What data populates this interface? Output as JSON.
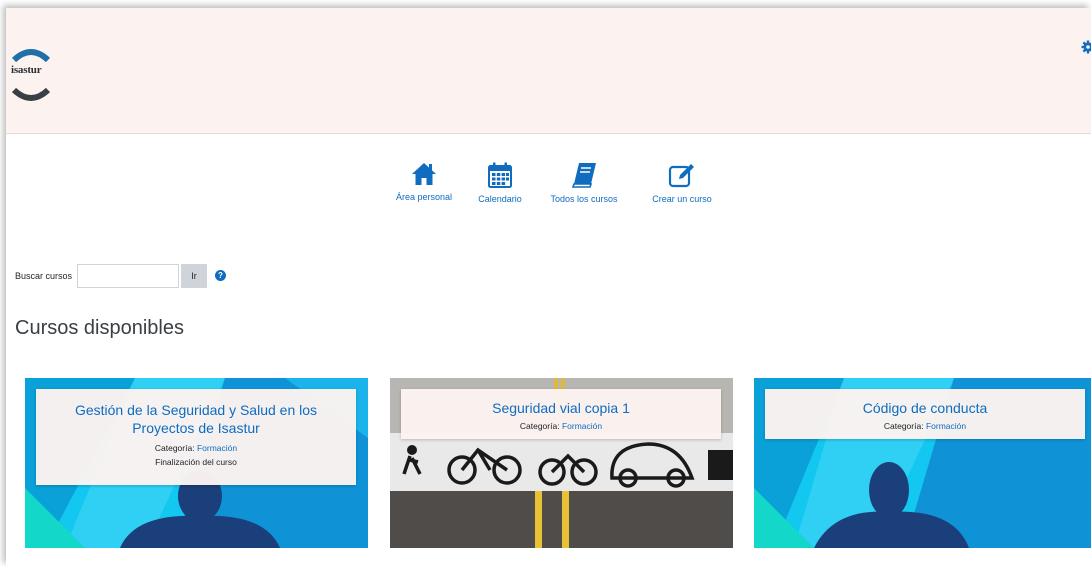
{
  "brand": {
    "logo_text": "isastur"
  },
  "nav": {
    "items": [
      {
        "label": "Área personal",
        "icon": "home-icon"
      },
      {
        "label": "Calendario",
        "icon": "calendar-icon"
      },
      {
        "label": "Todos los cursos",
        "icon": "book-icon"
      },
      {
        "label": "Crear un curso",
        "icon": "edit-icon"
      }
    ]
  },
  "search": {
    "label": "Buscar cursos",
    "value": "",
    "placeholder": "",
    "button_label": "Ir",
    "help_icon": "question-circle-icon"
  },
  "section_title": "Cursos disponibles",
  "courses": [
    {
      "title": "Gestión de la Seguridad y Salud en los Proyectos de Isastur",
      "category_label": "Categoría:",
      "category": "Formación",
      "extra": "Finalización del curso"
    },
    {
      "title": "Seguridad vial copia 1",
      "category_label": "Categoría:",
      "category": "Formación"
    },
    {
      "title": "Código de conducta",
      "category_label": "Categoría:",
      "category": "Formación"
    }
  ],
  "colors": {
    "link": "#0f6cbf",
    "header_bg": "#fcf3f1",
    "card_blue": "#14b4ec"
  }
}
